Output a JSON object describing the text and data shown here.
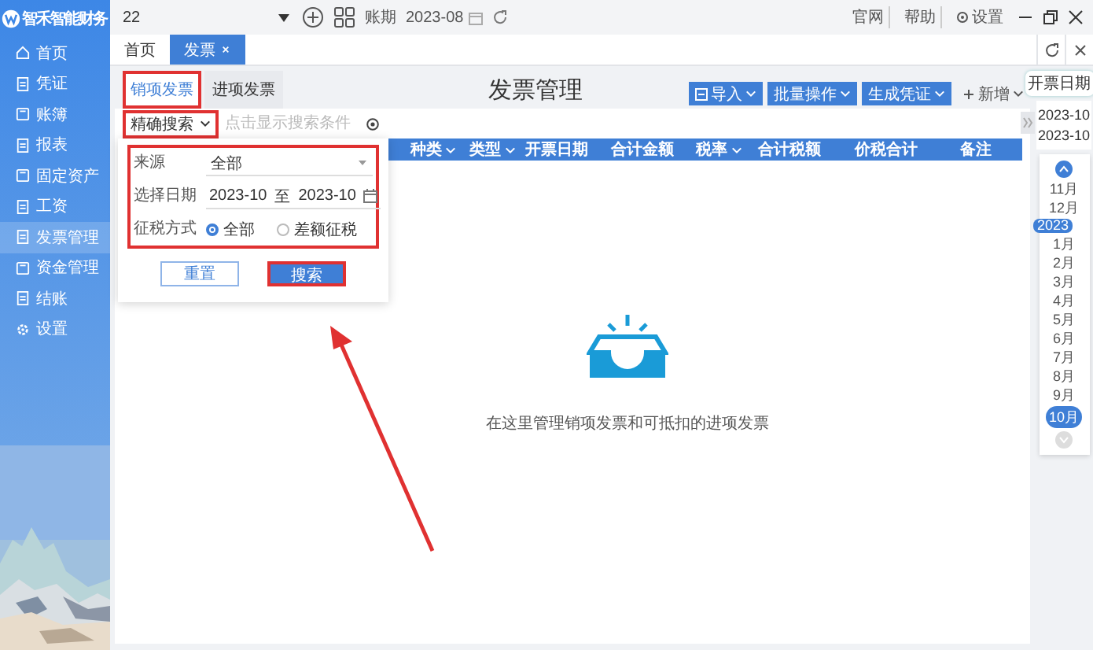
{
  "app": {
    "logo_text": "智禾智能财务"
  },
  "sidebar": {
    "items": [
      {
        "label": "首页",
        "selected": false
      },
      {
        "label": "凭证",
        "selected": false
      },
      {
        "label": "账簿",
        "selected": false
      },
      {
        "label": "报表",
        "selected": false
      },
      {
        "label": "固定资产",
        "selected": false
      },
      {
        "label": "工资",
        "selected": false
      },
      {
        "label": "发票管理",
        "selected": true
      },
      {
        "label": "资金管理",
        "selected": false
      },
      {
        "label": "结账",
        "selected": false
      },
      {
        "label": "设置",
        "selected": false
      }
    ]
  },
  "top_bar": {
    "account": "22",
    "period_label": "账期",
    "period": "2023-08",
    "links": [
      "官网",
      "帮助",
      "设置"
    ]
  },
  "page_tabs": [
    {
      "label": "首页",
      "selected": false,
      "closable": false
    },
    {
      "label": "发票",
      "selected": true,
      "closable": true
    }
  ],
  "invoice_tabs": [
    {
      "label": "销项发票",
      "selected": true,
      "highlighted": true
    },
    {
      "label": "进项发票",
      "selected": false,
      "highlighted": false
    }
  ],
  "title": "发票管理",
  "actions": [
    {
      "label": "导入",
      "kind": "import"
    },
    {
      "label": "批量操作",
      "kind": "menu"
    },
    {
      "label": "生成凭证",
      "kind": "menu"
    },
    {
      "label": "新增",
      "kind": "add"
    }
  ],
  "date_tooltip": "开票日期",
  "search": {
    "mode": "精确搜索",
    "mode_highlighted": true,
    "placeholder": "点击显示搜索条件"
  },
  "columns": [
    {
      "label": "种类",
      "sortable": true
    },
    {
      "label": "类型",
      "sortable": true
    },
    {
      "label": "开票日期",
      "sortable": false
    },
    {
      "label": "合计金额",
      "sortable": false
    },
    {
      "label": "税率",
      "sortable": true
    },
    {
      "label": "合计税额",
      "sortable": false
    },
    {
      "label": "价税合计",
      "sortable": false
    },
    {
      "label": "备注",
      "sortable": false
    }
  ],
  "search_panel": {
    "highlighted": true,
    "source_label": "来源",
    "source": "全部",
    "date_label": "选择日期",
    "date_from": "2023-10",
    "date_sep": "至",
    "date_to": "2023-10",
    "tax_label": "征税方式",
    "tax_options": [
      {
        "label": "全部",
        "selected": true
      },
      {
        "label": "差额征税",
        "selected": false
      }
    ],
    "buttons": [
      {
        "label": "重置",
        "kind": "secondary",
        "highlighted": false
      },
      {
        "label": "搜索",
        "kind": "primary",
        "highlighted": true
      }
    ]
  },
  "empty_message": "在这里管理销项发票和可抵扣的进项发票",
  "annotation_arrow": true,
  "timeline": {
    "range": [
      "2023-10",
      "2023-10"
    ],
    "items": [
      {
        "label": "11月",
        "kind": "month",
        "selected": false
      },
      {
        "label": "12月",
        "kind": "month",
        "selected": false
      },
      {
        "label": "2023",
        "kind": "year"
      },
      {
        "label": "1月",
        "kind": "month",
        "selected": false
      },
      {
        "label": "2月",
        "kind": "month",
        "selected": false
      },
      {
        "label": "3月",
        "kind": "month",
        "selected": false
      },
      {
        "label": "4月",
        "kind": "month",
        "selected": false
      },
      {
        "label": "5月",
        "kind": "month",
        "selected": false
      },
      {
        "label": "6月",
        "kind": "month",
        "selected": false
      },
      {
        "label": "7月",
        "kind": "month",
        "selected": false
      },
      {
        "label": "8月",
        "kind": "month",
        "selected": false
      },
      {
        "label": "9月",
        "kind": "month",
        "selected": false
      },
      {
        "label": "10月",
        "kind": "month",
        "selected": true
      }
    ]
  }
}
